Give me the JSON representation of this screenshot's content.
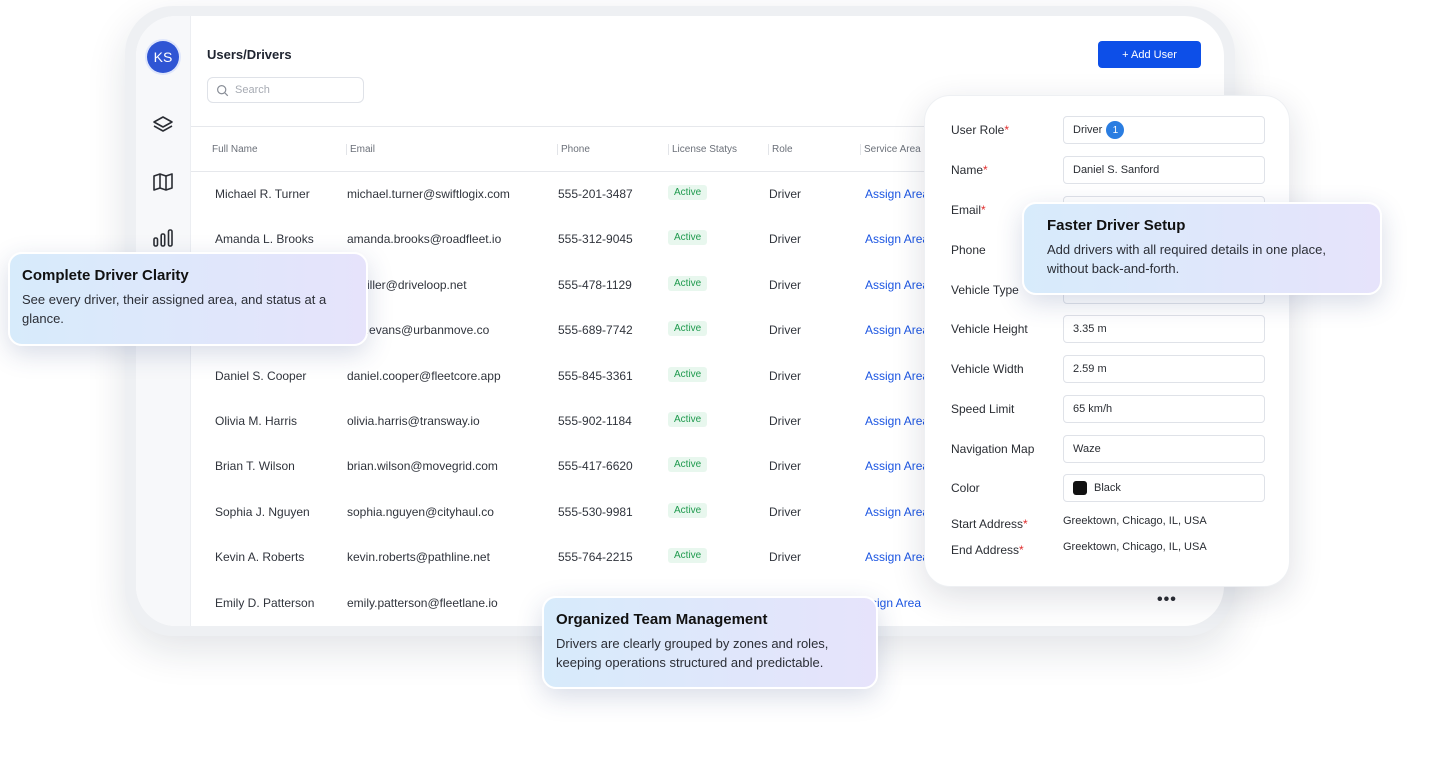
{
  "sidebar": {
    "avatar_initials": "KS",
    "icons": [
      "layers-icon",
      "map-icon",
      "bar-chart-icon"
    ]
  },
  "header": {
    "title": "Users/Drivers",
    "add_button_label": "+ Add User"
  },
  "search": {
    "placeholder": "Search"
  },
  "table": {
    "columns": [
      "Full Name",
      "Email",
      "Phone",
      "License Statys",
      "Role",
      "Service Area"
    ],
    "rows": [
      {
        "name": "Michael R. Turner",
        "email": "michael.turner@swiftlogix.com",
        "phone": "555-201-3487",
        "status": "Active",
        "role": "Driver",
        "area": "Assign Area"
      },
      {
        "name": "Amanda L. Brooks",
        "email": "amanda.brooks@roadfleet.io",
        "phone": "555-312-9045",
        "status": "Active",
        "role": "Driver",
        "area": "Assign Area"
      },
      {
        "name": "",
        "email": "n.miller@driveloop.net",
        "phone": "555-478-1129",
        "status": "Active",
        "role": "Driver",
        "area": "Assign Area"
      },
      {
        "name": "",
        "email": "niel.evans@urbanmove.co",
        "phone": "555-689-7742",
        "status": "Active",
        "role": "Driver",
        "area": "Assign Area"
      },
      {
        "name": "Daniel S. Cooper",
        "email": "daniel.cooper@fleetcore.app",
        "phone": "555-845-3361",
        "status": "Active",
        "role": "Driver",
        "area": "Assign Area"
      },
      {
        "name": "Olivia M. Harris",
        "email": "olivia.harris@transway.io",
        "phone": "555-902-1184",
        "status": "Active",
        "role": "Driver",
        "area": "Assign Area"
      },
      {
        "name": "Brian T. Wilson",
        "email": "brian.wilson@movegrid.com",
        "phone": "555-417-6620",
        "status": "Active",
        "role": "Driver",
        "area": "Assign Area"
      },
      {
        "name": "Sophia J. Nguyen",
        "email": "sophia.nguyen@cityhaul.co",
        "phone": "555-530-9981",
        "status": "Active",
        "role": "Driver",
        "area": "Assign Area"
      },
      {
        "name": "Kevin A. Roberts",
        "email": "kevin.roberts@pathline.net",
        "phone": "555-764-2215",
        "status": "Active",
        "role": "Driver",
        "area": "Assign Area"
      },
      {
        "name": "Emily D. Patterson",
        "email": "emily.patterson@fleetlane.io",
        "phone": "",
        "status": "",
        "role": "",
        "area": "ssign Area"
      }
    ],
    "more_label": "•••"
  },
  "form": {
    "user_role": {
      "label": "User Role",
      "value": "Driver",
      "badge": "1"
    },
    "name": {
      "label": "Name",
      "value": "Daniel S. Sanford"
    },
    "email": {
      "label": "Email"
    },
    "phone": {
      "label": "Phone"
    },
    "vehicle_type": {
      "label": "Vehicle Type"
    },
    "vehicle_height": {
      "label": "Vehicle Height",
      "value": "3.35 m"
    },
    "vehicle_width": {
      "label": "Vehicle Width",
      "value": "2.59 m"
    },
    "speed_limit": {
      "label": "Speed Limit",
      "value": "65 km/h"
    },
    "navigation_map": {
      "label": "Navigation Map",
      "value": "Waze"
    },
    "color": {
      "label": "Color",
      "value": "Black",
      "swatch": "#111111"
    },
    "start_address": {
      "label": "Start Address",
      "value": "Greektown, Chicago, IL, USA"
    },
    "end_address": {
      "label": "End Address",
      "value": "Greektown, Chicago, IL, USA"
    },
    "required_mark": "*"
  },
  "callouts": {
    "left": {
      "title": "Complete Driver Clarity",
      "body": "See every driver, their assigned area, and status at a glance."
    },
    "right": {
      "title": "Faster Driver Setup",
      "body": "Add drivers with all required details in one place, without back-and-forth."
    },
    "bottom": {
      "title": "Organized Team Management",
      "body": "Drivers are clearly grouped by zones and roles, keeping operations structured and predictable."
    }
  },
  "colors": {
    "primary": "#0d4fe8",
    "active_text": "#1f9a4e",
    "active_bg": "#e8f7ee",
    "link": "#1b55e2",
    "required": "#e02d2d"
  }
}
